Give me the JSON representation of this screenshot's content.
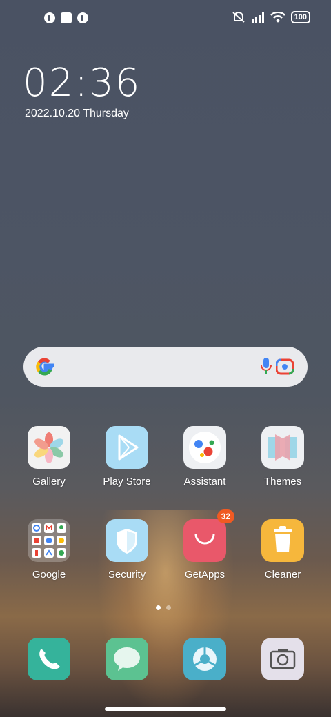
{
  "status_bar": {
    "battery": "100",
    "icons": [
      "notification-icon",
      "square-icon",
      "notification-icon",
      "silent-icon",
      "signal-icon",
      "wifi-icon",
      "battery-icon"
    ]
  },
  "clock": {
    "time": "02:36",
    "date": "2022.10.20 Thursday"
  },
  "search": {
    "icons": [
      "google-icon",
      "mic-icon",
      "lens-icon"
    ]
  },
  "apps": {
    "row1": [
      {
        "label": "Gallery",
        "icon": "gallery-icon"
      },
      {
        "label": "Play Store",
        "icon": "play-store-icon"
      },
      {
        "label": "Assistant",
        "icon": "assistant-icon"
      },
      {
        "label": "Themes",
        "icon": "themes-icon"
      }
    ],
    "row2": [
      {
        "label": "Google",
        "icon": "google-folder-icon"
      },
      {
        "label": "Security",
        "icon": "security-icon"
      },
      {
        "label": "GetApps",
        "icon": "getapps-icon",
        "badge": "32"
      },
      {
        "label": "Cleaner",
        "icon": "cleaner-icon"
      }
    ]
  },
  "page_indicator": {
    "pages": 2,
    "current": 1
  },
  "dock": [
    {
      "icon": "phone-icon"
    },
    {
      "icon": "messages-icon"
    },
    {
      "icon": "browser-icon"
    },
    {
      "icon": "camera-icon"
    }
  ],
  "colors": {
    "play_store": "#a9dcf5",
    "security": "#a9dcf5",
    "getapps": "#e9586a",
    "cleaner": "#f6b73c",
    "phone": "#35b39b",
    "messages": "#5cc291",
    "browser": "#4aafc9",
    "camera": "#e4e0ea",
    "badge": "#f05a22"
  }
}
